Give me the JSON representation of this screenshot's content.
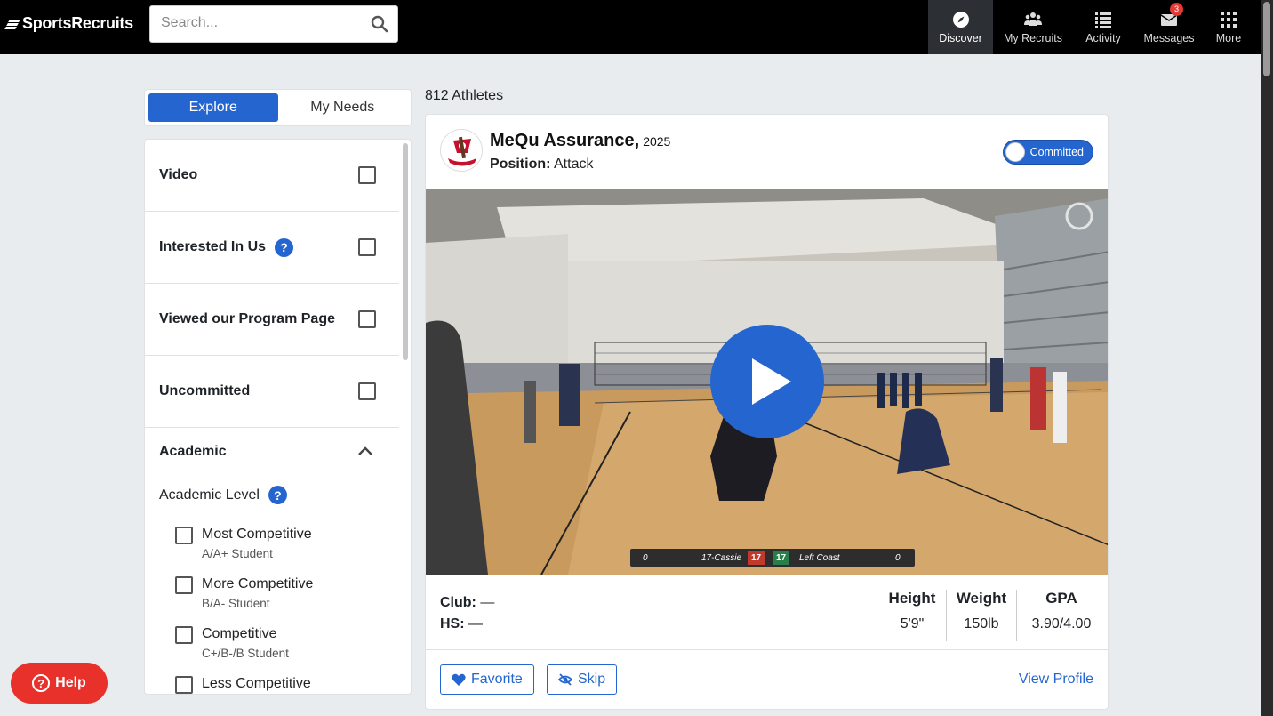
{
  "brand": {
    "name": "SportsRecruits"
  },
  "search": {
    "placeholder": "Search..."
  },
  "nav": {
    "items": [
      {
        "label": "Discover",
        "icon": "compass-icon",
        "active": true
      },
      {
        "label": "My Recruits",
        "icon": "users-icon"
      },
      {
        "label": "Activity",
        "icon": "list-icon"
      },
      {
        "label": "Messages",
        "icon": "mail-icon",
        "badge": "3"
      },
      {
        "label": "More",
        "icon": "grid-icon"
      }
    ]
  },
  "tabs": [
    {
      "label": "Explore",
      "active": true
    },
    {
      "label": "My Needs"
    }
  ],
  "filters": {
    "rows": [
      {
        "label": "Video"
      },
      {
        "label": "Interested In Us",
        "help": "?"
      },
      {
        "label": "Viewed our Program Page"
      },
      {
        "label": "Uncommitted"
      }
    ],
    "academic": {
      "title": "Academic",
      "level_label": "Academic Level",
      "help": "?",
      "options": [
        {
          "label": "Most Competitive",
          "sub": "A/A+ Student"
        },
        {
          "label": "More Competitive",
          "sub": "B/A- Student"
        },
        {
          "label": "Competitive",
          "sub": "C+/B-/B Student"
        },
        {
          "label": "Less Competitive",
          "sub": ""
        }
      ]
    }
  },
  "results": {
    "count_text": "812 Athletes"
  },
  "athlete": {
    "name": "MeQu Assurance,",
    "year": "2025",
    "position_label": "Position:",
    "position": "Attack",
    "status": "Committed",
    "scoreboard": {
      "left_score": "0",
      "left_team": "17-Cassie",
      "set_left": "17",
      "set_right": "17",
      "right_team": "Left Coast",
      "right_score": "0"
    },
    "club_label": "Club:",
    "club": "—",
    "hs_label": "HS:",
    "hs": "—",
    "stats": [
      {
        "label": "Height",
        "value": "5'9\""
      },
      {
        "label": "Weight",
        "value": "150lb"
      },
      {
        "label": "GPA",
        "value": "3.90/4.00"
      }
    ],
    "actions": {
      "favorite": "Favorite",
      "skip": "Skip",
      "view_profile": "View Profile"
    }
  },
  "help": {
    "label": "Help",
    "icon_text": "?"
  },
  "colors": {
    "accent": "#2565cf",
    "help": "#e8312a",
    "topbar": "#000000"
  }
}
